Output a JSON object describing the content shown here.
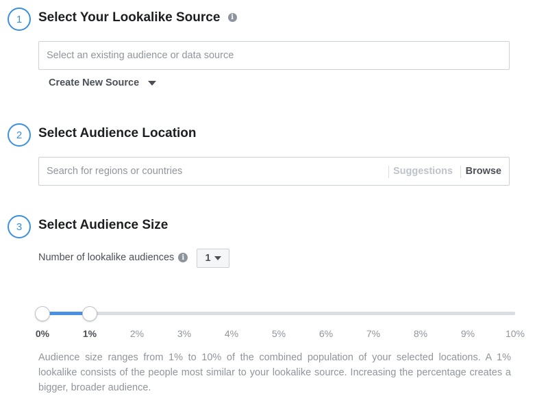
{
  "steps": [
    {
      "number": "1",
      "title": "Select Your Lookalike Source"
    },
    {
      "number": "2",
      "title": "Select Audience Location"
    },
    {
      "number": "3",
      "title": "Select Audience Size"
    }
  ],
  "source": {
    "placeholder": "Select an existing audience or data source",
    "create_label": "Create New Source"
  },
  "location": {
    "placeholder": "Search for regions or countries",
    "suggestions_label": "Suggestions",
    "browse_label": "Browse"
  },
  "size": {
    "count_label": "Number of lookalike audiences",
    "count_value": "1",
    "range_min_percent": 0,
    "range_max_percent": 1,
    "ticks": [
      "0%",
      "1%",
      "2%",
      "3%",
      "4%",
      "5%",
      "6%",
      "7%",
      "8%",
      "9%",
      "10%"
    ],
    "help_text": "Audience size ranges from 1% to 10% of the combined population of your selected locations. A 1% lookalike consists of the people most similar to your lookalike source. Increasing the percentage creates a bigger, broader audience."
  },
  "icons": {
    "info": "info-icon",
    "dropdown": "caret-down-icon"
  },
  "colors": {
    "accent": "#3b8fe0",
    "slider_fill": "#4a90e2"
  }
}
